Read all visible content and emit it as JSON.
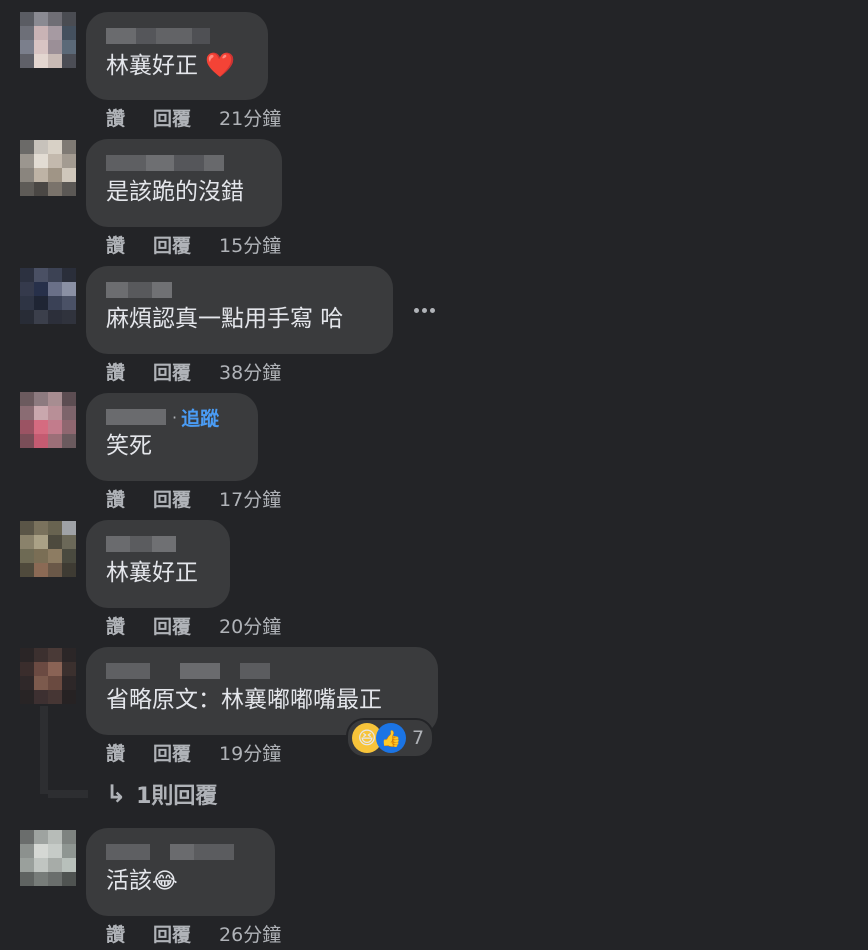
{
  "comments": [
    {
      "text": "林襄好正",
      "emoji": "❤️",
      "like_label": "讚",
      "reply_label": "回覆",
      "time": "21分鐘"
    },
    {
      "text": "是該跪的沒錯",
      "like_label": "讚",
      "reply_label": "回覆",
      "time": "15分鐘"
    },
    {
      "text": "麻煩認真一點用手寫 哈",
      "like_label": "讚",
      "reply_label": "回覆",
      "time": "38分鐘"
    },
    {
      "text": "笑死",
      "follow_separator": "·",
      "follow_label": "追蹤",
      "like_label": "讚",
      "reply_label": "回覆",
      "time": "17分鐘"
    },
    {
      "text": "林襄好正",
      "like_label": "讚",
      "reply_label": "回覆",
      "time": "20分鐘"
    },
    {
      "text": "省略原文：林襄嘟嘟嘴最正",
      "like_label": "讚",
      "reply_label": "回覆",
      "time": "19分鐘",
      "reaction_count": "7",
      "reaction_icons": [
        "haha-emoji-icon",
        "like-thumb-icon"
      ],
      "view_replies_label": "1則回覆"
    },
    {
      "text": "活該",
      "emoji": "😂",
      "like_label": "讚",
      "reply_label": "回覆",
      "time": "26分鐘"
    }
  ],
  "colors": {
    "background": "#232427",
    "bubble": "#3a3b3d",
    "text": "#e4e6eb",
    "muted": "#b0b3b8",
    "follow": "#4a9cf5",
    "like_blue": "#1b74e4",
    "heart": "#f0284a"
  }
}
